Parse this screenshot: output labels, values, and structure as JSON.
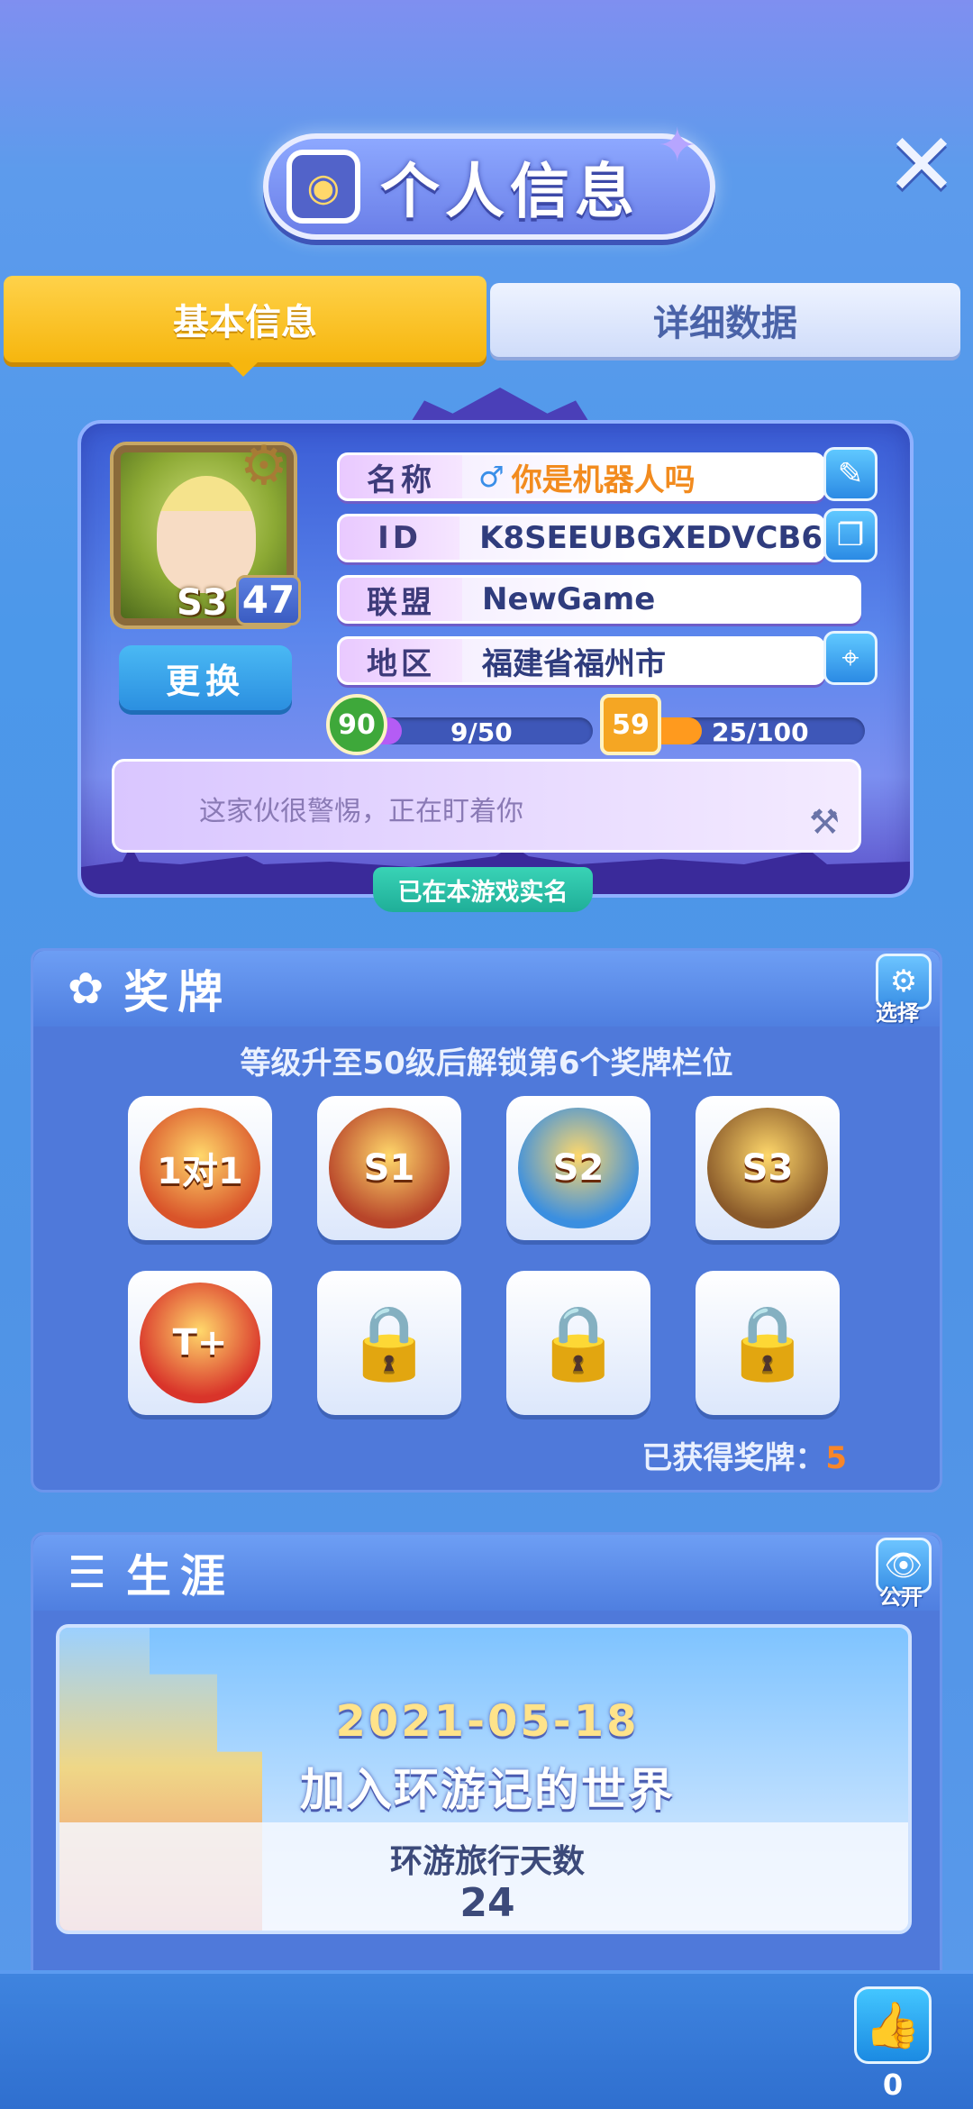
{
  "header": {
    "title": "个人信息",
    "title_icon": "profile-badge-icon",
    "close_icon": "close-icon"
  },
  "tabs": [
    {
      "label": "基本信息",
      "active": true
    },
    {
      "label": "详细数据",
      "active": false
    }
  ],
  "profile": {
    "avatar_season": "S3",
    "avatar_level": "47",
    "change_label": "更换",
    "rows": [
      {
        "label": "名称",
        "value": "你是机器人吗",
        "icon": "edit-icon"
      },
      {
        "label": "ID",
        "value": "K8SEEUBGXEDVCB6",
        "icon": "copy-icon"
      },
      {
        "label": "联盟",
        "value": "NewGame",
        "icon": ""
      },
      {
        "label": "地区",
        "value": "福建省福州市",
        "icon": "location-pin-icon"
      }
    ],
    "progress": [
      {
        "badge": "90",
        "text": "9/50",
        "fraction": 0.18,
        "color": "#b45cf5",
        "badge_color": "#3ea83a"
      },
      {
        "badge": "59",
        "text": "25/100",
        "fraction": 0.25,
        "color": "#ff9a1e",
        "badge_color": "#f5a623"
      }
    ],
    "signature": "这家伙很警惕，正在盯着你",
    "realname_label": "已在本游戏实名"
  },
  "medals": {
    "title": "奖牌",
    "select_label": "选择",
    "hint": "等级升至50级后解锁第6个奖牌栏位",
    "items": [
      {
        "label": "1对1",
        "locked": false,
        "color": "#d9542a"
      },
      {
        "label": "S1",
        "locked": false,
        "color": "#b8452a"
      },
      {
        "label": "S2",
        "locked": false,
        "color": "#3b8fe0"
      },
      {
        "label": "S3",
        "locked": false,
        "color": "#8a5a2a"
      },
      {
        "label": "T+",
        "locked": false,
        "color": "#d9342a"
      },
      {
        "label": "",
        "locked": true,
        "color": "#4c82d8"
      },
      {
        "label": "",
        "locked": true,
        "color": "#4c82d8"
      },
      {
        "label": "",
        "locked": true,
        "color": "#4c82d8"
      }
    ],
    "count_label": "已获得奖牌：",
    "count": "5"
  },
  "career": {
    "title": "生涯",
    "public_label": "公开",
    "date": "2021-05-18",
    "join_text": "加入环游记的世界",
    "days_label": "环游旅行天数",
    "days": "24"
  },
  "bottom": {
    "like_count": "0"
  }
}
